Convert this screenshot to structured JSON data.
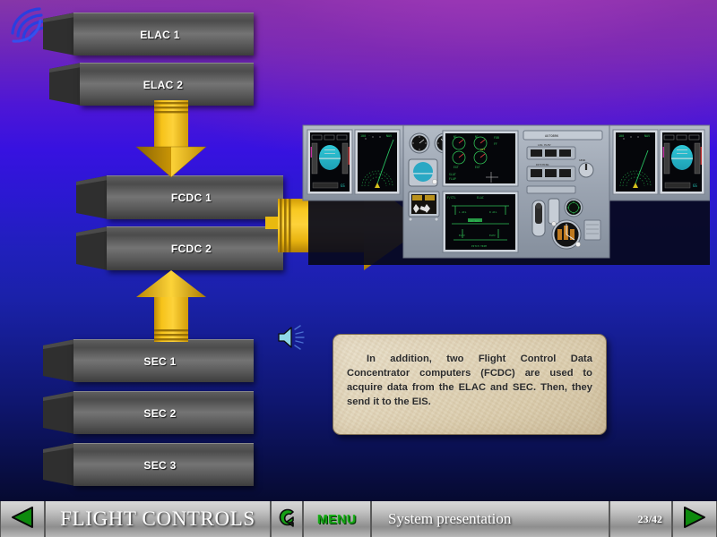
{
  "slide": {
    "logo_icon": "swirl-logo-icon",
    "computers": [
      {
        "id": "elac1",
        "label": "ELAC 1"
      },
      {
        "id": "elac2",
        "label": "ELAC 2"
      },
      {
        "id": "fcdc1",
        "label": "FCDC 1"
      },
      {
        "id": "fcdc2",
        "label": "FCDC 2"
      },
      {
        "id": "sec1",
        "label": "SEC 1"
      },
      {
        "id": "sec2",
        "label": "SEC 2"
      },
      {
        "id": "sec3",
        "label": "SEC 3"
      }
    ],
    "arrows": [
      {
        "id": "elac-to-fcdc",
        "direction": "down",
        "color": "#F2B50A"
      },
      {
        "id": "sec-to-fcdc",
        "direction": "up",
        "color": "#F2B50A"
      },
      {
        "id": "fcdc-to-eis",
        "direction": "right",
        "color": "#F2B50A"
      }
    ],
    "cockpit": {
      "name": "eis-cockpit-panel",
      "displays": [
        "PFD",
        "ND",
        "E/WD",
        "SD",
        "ND",
        "PFD"
      ]
    },
    "audio_icon": "speaker-icon",
    "note": {
      "text": "In addition, two Flight Control Data Concentrator computers (FCDC) are used to acquire data from the ELAC and SEC. Then, they send it to the EIS."
    }
  },
  "bottombar": {
    "prev_icon": "previous-triangle-icon",
    "title": "FLIGHT CONTROLS",
    "loop_icon": "return-loop-icon",
    "menu_label": "MENU",
    "section": "System  presentation",
    "page": "23/42",
    "next_icon": "next-triangle-icon"
  },
  "colors": {
    "arrow_yellow": "#F2B50A",
    "accent_green": "#15a015",
    "bg_top": "#8636a8",
    "bg_bottom": "#060a30"
  }
}
